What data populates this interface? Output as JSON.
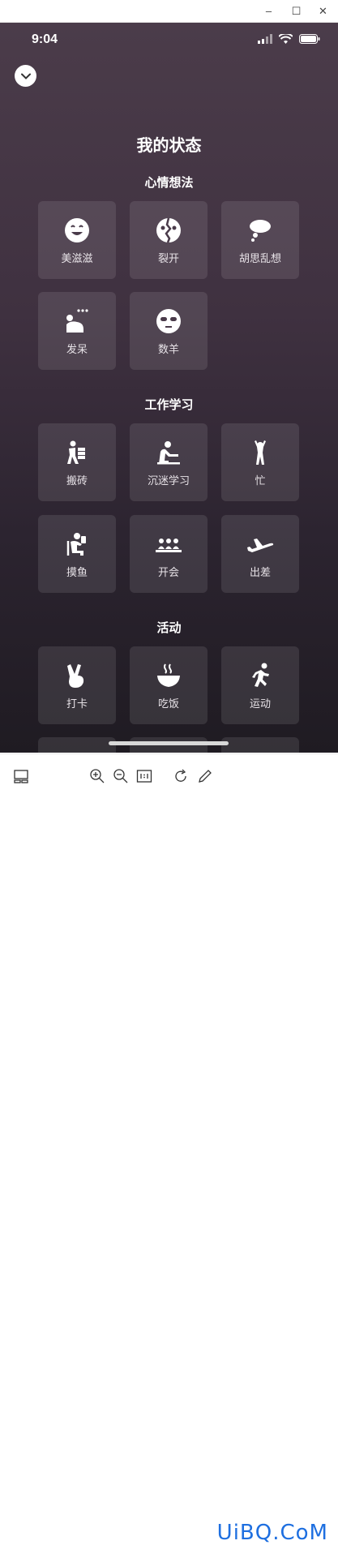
{
  "statusbar": {
    "time": "9:04"
  },
  "page": {
    "title": "我的状态"
  },
  "sections": [
    {
      "title": "心情想法",
      "items": [
        {
          "label": "美滋滋",
          "icon": "happy-face-icon"
        },
        {
          "label": "裂开",
          "icon": "cracked-face-icon"
        },
        {
          "label": "胡思乱想",
          "icon": "thought-cloud-icon"
        },
        {
          "label": "发呆",
          "icon": "daydream-icon"
        },
        {
          "label": "数羊",
          "icon": "sheep-face-icon"
        }
      ]
    },
    {
      "title": "工作学习",
      "items": [
        {
          "label": "搬砖",
          "icon": "carry-bricks-icon"
        },
        {
          "label": "沉迷学习",
          "icon": "study-icon"
        },
        {
          "label": "忙",
          "icon": "busy-icon"
        },
        {
          "label": "摸鱼",
          "icon": "slacking-icon"
        },
        {
          "label": "开会",
          "icon": "meeting-icon"
        },
        {
          "label": "出差",
          "icon": "airplane-icon"
        }
      ]
    },
    {
      "title": "活动",
      "items": [
        {
          "label": "打卡",
          "icon": "peace-hand-icon"
        },
        {
          "label": "吃饭",
          "icon": "food-bowl-icon"
        },
        {
          "label": "运动",
          "icon": "running-icon"
        }
      ]
    }
  ],
  "watermark": "UiBQ.CoM",
  "colors": {
    "accent": "#1e6fe0",
    "tile_bg": "rgba(255,255,255,0.10)"
  }
}
